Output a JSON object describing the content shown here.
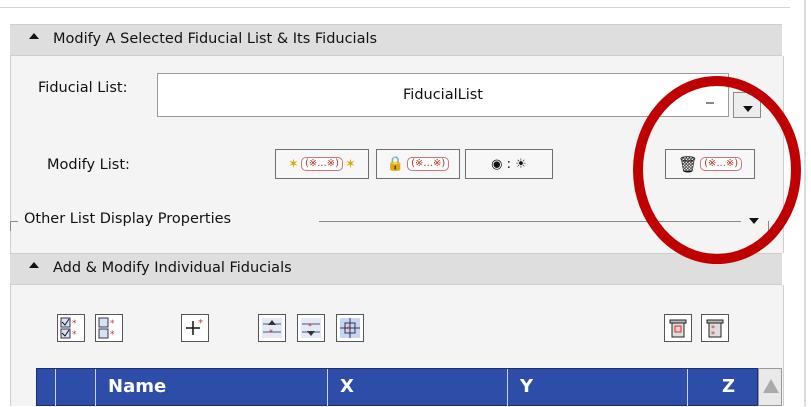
{
  "section1": {
    "title": "Modify A Selected Fiducial List & Its Fiducials"
  },
  "fiducial_list": {
    "label": "Fiducial List:",
    "value": "FiducialList"
  },
  "modify_list": {
    "label": "Modify List:",
    "buttons": [
      {
        "name": "select-all",
        "text": "(※...※)"
      },
      {
        "name": "lock",
        "text": "(※...※)"
      },
      {
        "name": "visibility",
        "text": "◉ : ☀"
      },
      {
        "name": "delete",
        "text": "(※...※)"
      }
    ]
  },
  "other_props": {
    "label": "Other List Display Properties"
  },
  "section2": {
    "title": "Add & Modify Individual Fiducials"
  },
  "table": {
    "columns": [
      "Name",
      "X",
      "Y",
      "Z"
    ]
  },
  "colors": {
    "header_blue": "#2d4da8",
    "highlight_red": "#c00000"
  }
}
